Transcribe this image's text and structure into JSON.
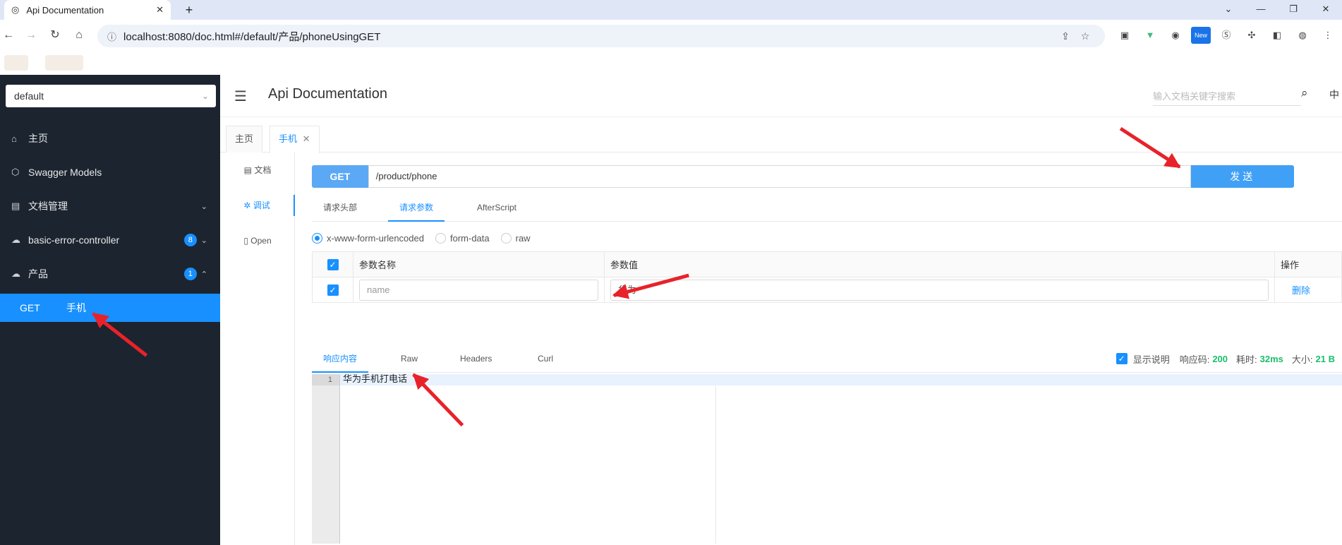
{
  "browser": {
    "tab_title": "Api Documentation",
    "url": "localhost:8080/doc.html#/default/产品/phoneUsingGET",
    "new_label": "New"
  },
  "sidebar": {
    "project_select": "default",
    "items": [
      {
        "icon": "home-icon",
        "label": "主页"
      },
      {
        "icon": "cube-icon",
        "label": "Swagger Models"
      },
      {
        "icon": "doc-manage-icon",
        "label": "文档管理"
      },
      {
        "icon": "cloud-icon",
        "label": "basic-error-controller",
        "badge": "8"
      },
      {
        "icon": "cloud-icon",
        "label": "产品",
        "badge": "1"
      }
    ],
    "active_sub": {
      "method": "GET",
      "label": "手机"
    }
  },
  "header": {
    "title": "Api Documentation",
    "search_placeholder": "输入文档关键字搜索",
    "lang": "中"
  },
  "page_tabs": [
    {
      "label": "主页"
    },
    {
      "label": "手机"
    }
  ],
  "sub_nav": [
    {
      "icon": "document-icon",
      "label": "文档"
    },
    {
      "icon": "bug-icon",
      "label": "调试"
    },
    {
      "icon": "file-icon",
      "label": "Open"
    }
  ],
  "request": {
    "method": "GET",
    "path": "/product/phone",
    "send_label": "发送",
    "tabs": [
      "请求头部",
      "请求参数",
      "AfterScript"
    ],
    "active_tab": 1,
    "body_types": [
      "x-www-form-urlencoded",
      "form-data",
      "raw"
    ],
    "selected_body_type": 0,
    "param_headers": {
      "name": "参数名称",
      "value": "参数值",
      "op": "操作"
    },
    "params": [
      {
        "checked": true,
        "name_placeholder": "name",
        "value": "华为",
        "action": "删除"
      }
    ]
  },
  "response": {
    "tabs": [
      "响应内容",
      "Raw",
      "Headers",
      "Curl"
    ],
    "active_tab": 0,
    "show_desc_label": "显示说明",
    "code_label": "响应码:",
    "code": "200",
    "time_label": "耗时:",
    "time": "32ms",
    "size_label": "大小:",
    "size": "21 B",
    "lines": [
      {
        "num": "1",
        "text": "华为手机打电话"
      }
    ]
  },
  "colors": {
    "accent": "#1890ff",
    "sidebar_bg": "#1c2430",
    "get_method": "#5ba8f5",
    "send_button": "#40a0f6",
    "success": "#19be6b",
    "annotation_arrow": "#e8222a"
  }
}
